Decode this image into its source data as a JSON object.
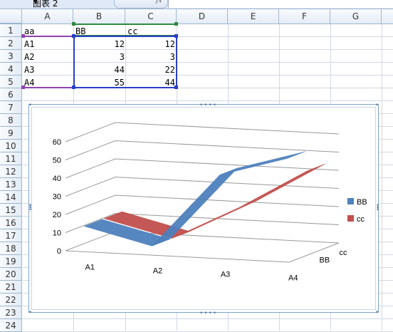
{
  "name_box": {
    "value": "图表 2"
  },
  "formula_bar": {
    "fx_label": "fx",
    "value": ""
  },
  "columns": [
    "A",
    "B",
    "C",
    "D",
    "E",
    "F",
    "G"
  ],
  "rows": [
    "1",
    "2",
    "3",
    "4",
    "5",
    "6",
    "7",
    "8",
    "9",
    "10",
    "11",
    "12",
    "13",
    "14",
    "15",
    "16",
    "17",
    "18",
    "19",
    "20",
    "21",
    "22",
    "23",
    "24"
  ],
  "sheet": {
    "header": [
      "aa",
      "BB",
      "cc"
    ],
    "data": [
      [
        "A1",
        "12",
        "12"
      ],
      [
        "A2",
        "3",
        "3"
      ],
      [
        "A3",
        "44",
        "22"
      ],
      [
        "A4",
        "55",
        "44"
      ]
    ]
  },
  "colors": {
    "series_bb": "#4f81bd",
    "series_cc": "#c0504d",
    "header_bg": "#e4ecf7",
    "grid": "#d0d7e5"
  },
  "chart_data": {
    "type": "line",
    "variant": "3d-line",
    "categories": [
      "A1",
      "A2",
      "A3",
      "A4"
    ],
    "series": [
      {
        "name": "BB",
        "values": [
          12,
          3,
          44,
          55
        ],
        "color": "#4f81bd"
      },
      {
        "name": "cc",
        "values": [
          12,
          3,
          22,
          44
        ],
        "color": "#c0504d"
      }
    ],
    "y_ticks": [
      "0",
      "10",
      "20",
      "30",
      "40",
      "50",
      "60"
    ],
    "ylim": [
      0,
      60
    ],
    "depth_labels": [
      "cc",
      "BB"
    ],
    "legend": [
      "BB",
      "cc"
    ],
    "legend_position": "right",
    "grid": true
  }
}
